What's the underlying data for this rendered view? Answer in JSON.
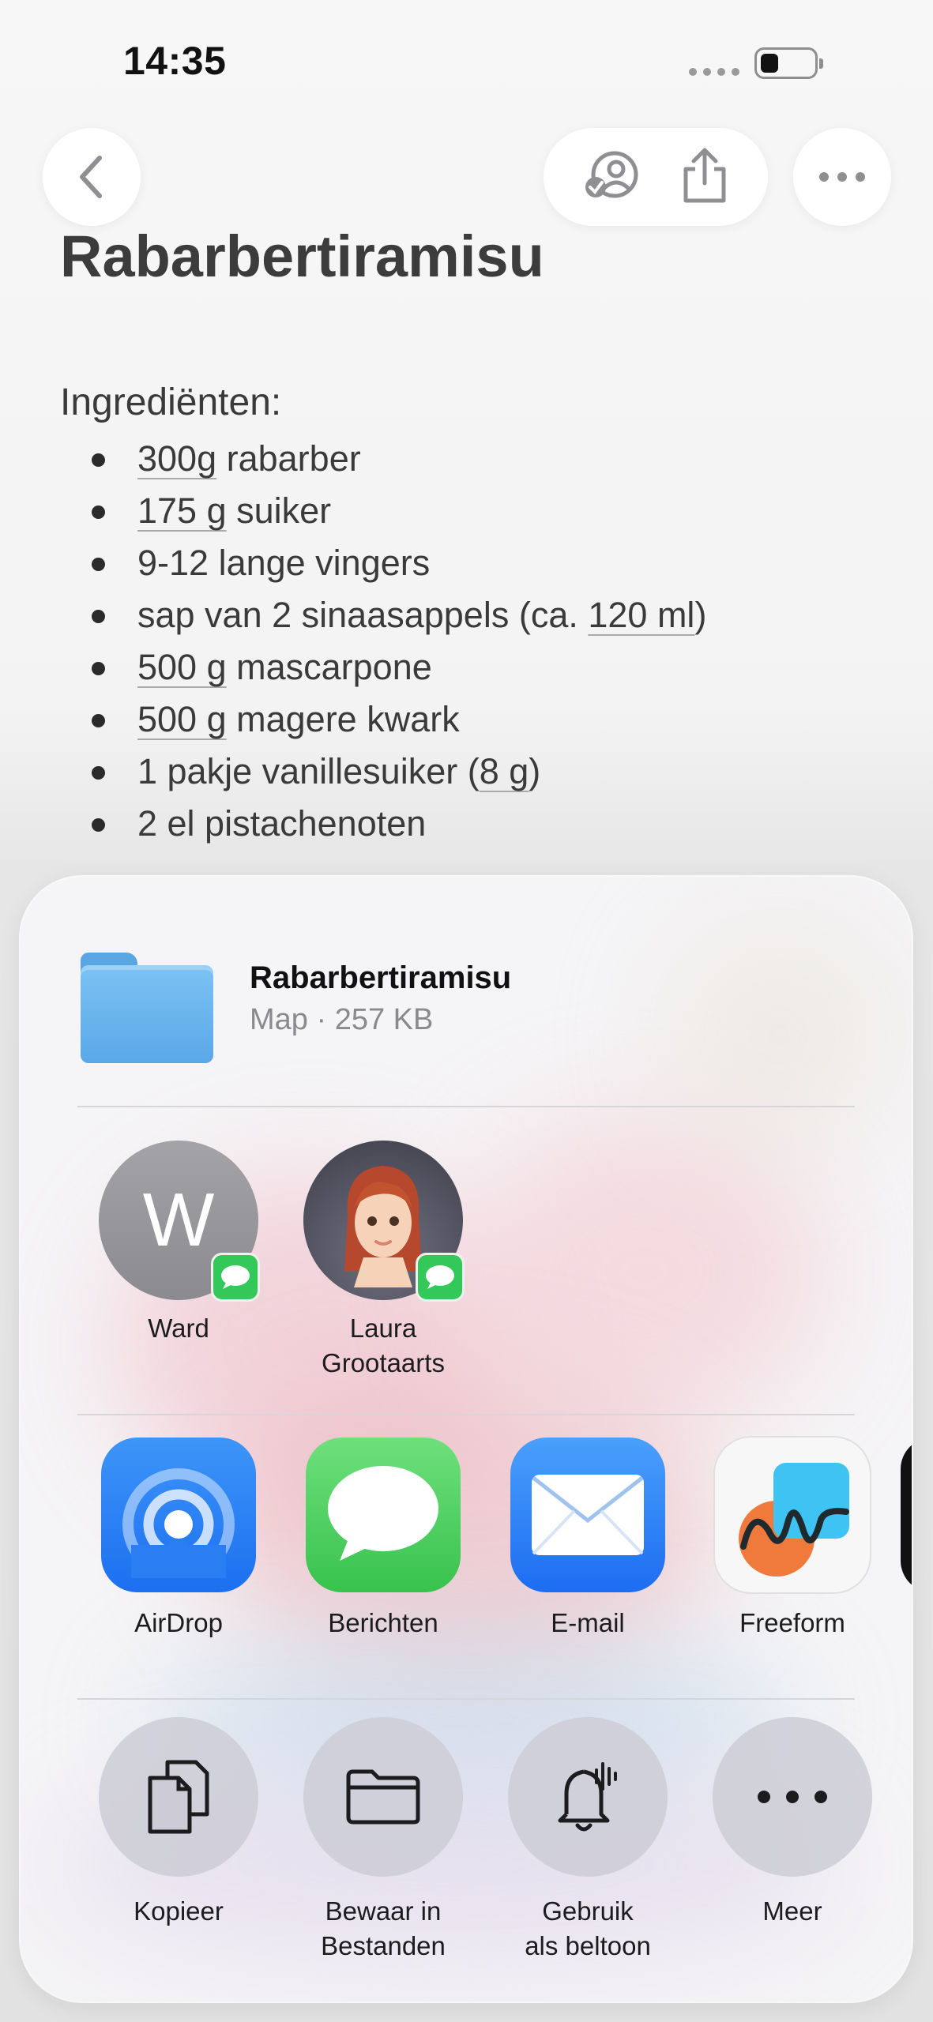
{
  "status_bar": {
    "time": "14:35"
  },
  "note": {
    "title": "Rabarbertiramisu",
    "ingredients_heading": "Ingrediënten:",
    "ingredients": [
      {
        "amount": "300g",
        "rest": " rabarber"
      },
      {
        "amount": "175 g",
        "rest": " suiker"
      },
      {
        "amount": "",
        "rest": "9-12 lange vingers"
      },
      {
        "pre": "sap van 2 sinaasappels (ca. ",
        "amount": "120 ml",
        "rest": ")"
      },
      {
        "amount": "500 g",
        "rest": " mascarpone"
      },
      {
        "amount": "500 g",
        "rest": " magere kwark"
      },
      {
        "pre": "1 pakje vanillesuiker (",
        "amount": "8 g",
        "rest": ")"
      },
      {
        "amount": "",
        "rest": "2 el pistachenoten"
      }
    ]
  },
  "share_sheet": {
    "file": {
      "name": "Rabarbertiramisu",
      "meta": "Map · 257 KB"
    },
    "people": [
      {
        "initial": "W",
        "name": "Ward"
      },
      {
        "name_line1": "Laura",
        "name_line2": "Grootaarts"
      }
    ],
    "apps": [
      {
        "label": "AirDrop"
      },
      {
        "label": "Berichten"
      },
      {
        "label": "E-mail"
      },
      {
        "label": "Freeform"
      }
    ],
    "actions": [
      {
        "line1": "Kopieer",
        "line2": ""
      },
      {
        "line1": "Bewaar in",
        "line2": "Bestanden"
      },
      {
        "line1": "Gebruik",
        "line2": "als beltoon"
      },
      {
        "line1": "Meer",
        "line2": ""
      }
    ]
  },
  "colors": {
    "accent_green": "#34c759",
    "accent_blue": "#1c6ff0",
    "folder_blue": "#5aa8e8"
  }
}
